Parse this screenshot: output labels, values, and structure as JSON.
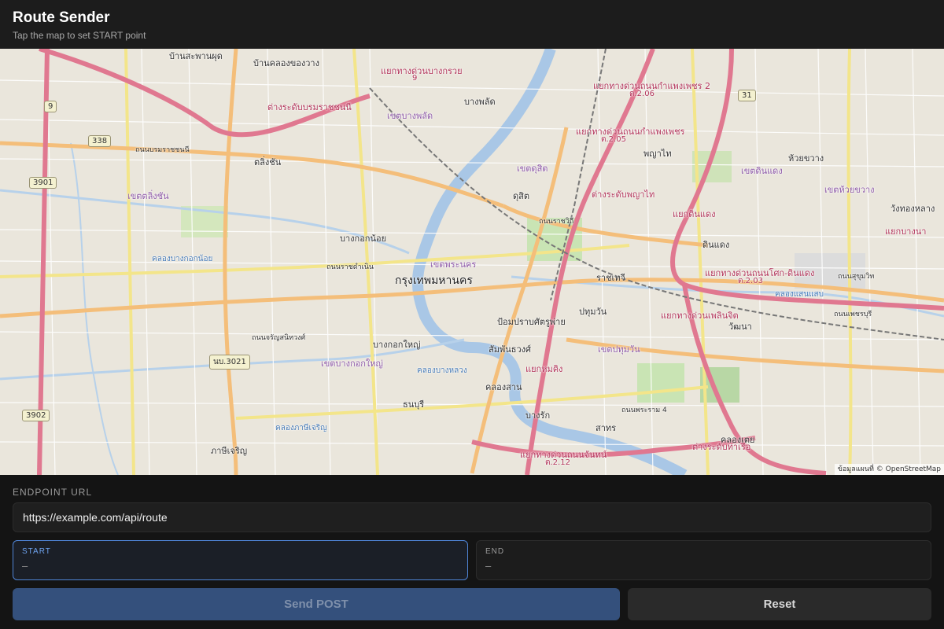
{
  "header": {
    "title": "Route Sender",
    "subtitle": "Tap the map to set START point"
  },
  "map": {
    "labels": {
      "bangkok": "กรุงเทพมหานคร",
      "bang_phlat": "บางพลัด",
      "phaya_thai": "พญาไท",
      "huai_khwang": "ห้วยขวาง",
      "talingchan": "ตลิ่งชัน",
      "bang_kok_noi": "บางกอกน้อย",
      "dusit": "ดุสิต",
      "ratchathewi": "ราชเทวี",
      "din_daeng": "ดินแดง",
      "pathum_wan": "ปทุมวัน",
      "wattana": "วัฒนา",
      "pom_prap": "ป้อมปราบศัตรูพ่าย",
      "samphanthawong": "สัมพันธวงศ์",
      "bang_kok_yai": "บางกอกใหญ่",
      "khlong_san": "คลองสาน",
      "thon_buri": "ธนบุรี",
      "bang_rak": "บางรัก",
      "sathon": "สาทร",
      "khlong_toei": "คลองเตย",
      "phasi_charoen": "ภาษีเจริญ",
      "wang_thonglang": "วังทองหลาง",
      "ban_sapan_phut": "บ้านสะพานผุด",
      "ban_khlong_song": "บ้านคลองของวาง",
      "khet_phra_nakhon": "เขตพระนคร",
      "khet_dusit": "เขตดุสิต",
      "khet_pathum_wan": "เขตปทุมวัน",
      "khet_din_daeng": "เขตดินแดง",
      "khet_huai_khwang": "เขตห้วยขวาง",
      "khet_bang_kok_yai": "เขตบางกอกใหญ่",
      "khet_bang_phlat": "เขตบางพลัด",
      "khet_taling_chan": "เขตตลิ่งชัน",
      "interchange_1": "แยกทางด่วนบางกรวย",
      "interchange_2": "แยกทางด่วนถนนกำแพงเพชร 2",
      "interchange_3": "แยกทางด่วนถนนกำแพงเพชร",
      "interchange_4": "ต่างระดับพญาไท",
      "interchange_5": "แยกดินแดง",
      "interchange_6": "แยกทางด่วนถนนโศก-ดินแดง",
      "interchange_7": "แยกทางด่วนเพลินจิต",
      "interchange_8": "แยกทางด่วนถนนจันทน์",
      "interchange_9": "ต่างระดับท่าเรือ",
      "interchange_10": "แยกบางนา",
      "interchange_11": "ต่างระดับบรมราชชนนี",
      "interchange_12": "แยกหมคิง",
      "road_ratchawithi": "ถนนราชวิถี",
      "road_sukhumvit": "ถนนสุขุมวิท",
      "road_phetchaburi": "ถนนเพชรบุรี",
      "road_pracharat": "ถนนบรมราชชนนี",
      "road_ratchadamnoen": "ถนนราชดำเนิน",
      "road_rama4": "ถนนพระราม 4",
      "road_charansanitwong": "ถนนจรัญสนิทวงศ์",
      "khlong_1": "คลองบางกอกน้อย",
      "khlong_2": "คลองบางหลวง",
      "khlong_3": "คลองแสนแสบ",
      "khlong_4": "คลองภาษีเจริญ",
      "expressway_2_06": "ต.2.06",
      "expressway_2_05": "ต.2.05",
      "expressway_2_03": "ต.2.03",
      "expressway_2_12": "ต.2.12",
      "expressway_9": "9"
    },
    "shields": {
      "s9": "9",
      "s338": "338",
      "s3901": "3901",
      "s31": "31",
      "s3902": "3902",
      "s3021": "นบ.3021"
    },
    "attribution": "ข้อมูลแผนที่ © OpenStreetMap"
  },
  "form": {
    "endpoint_label": "ENDPOINT URL",
    "endpoint_value": "https://example.com/api/route",
    "start_label": "START",
    "start_value": "–",
    "end_label": "END",
    "end_value": "–",
    "send_label": "Send POST",
    "reset_label": "Reset"
  }
}
